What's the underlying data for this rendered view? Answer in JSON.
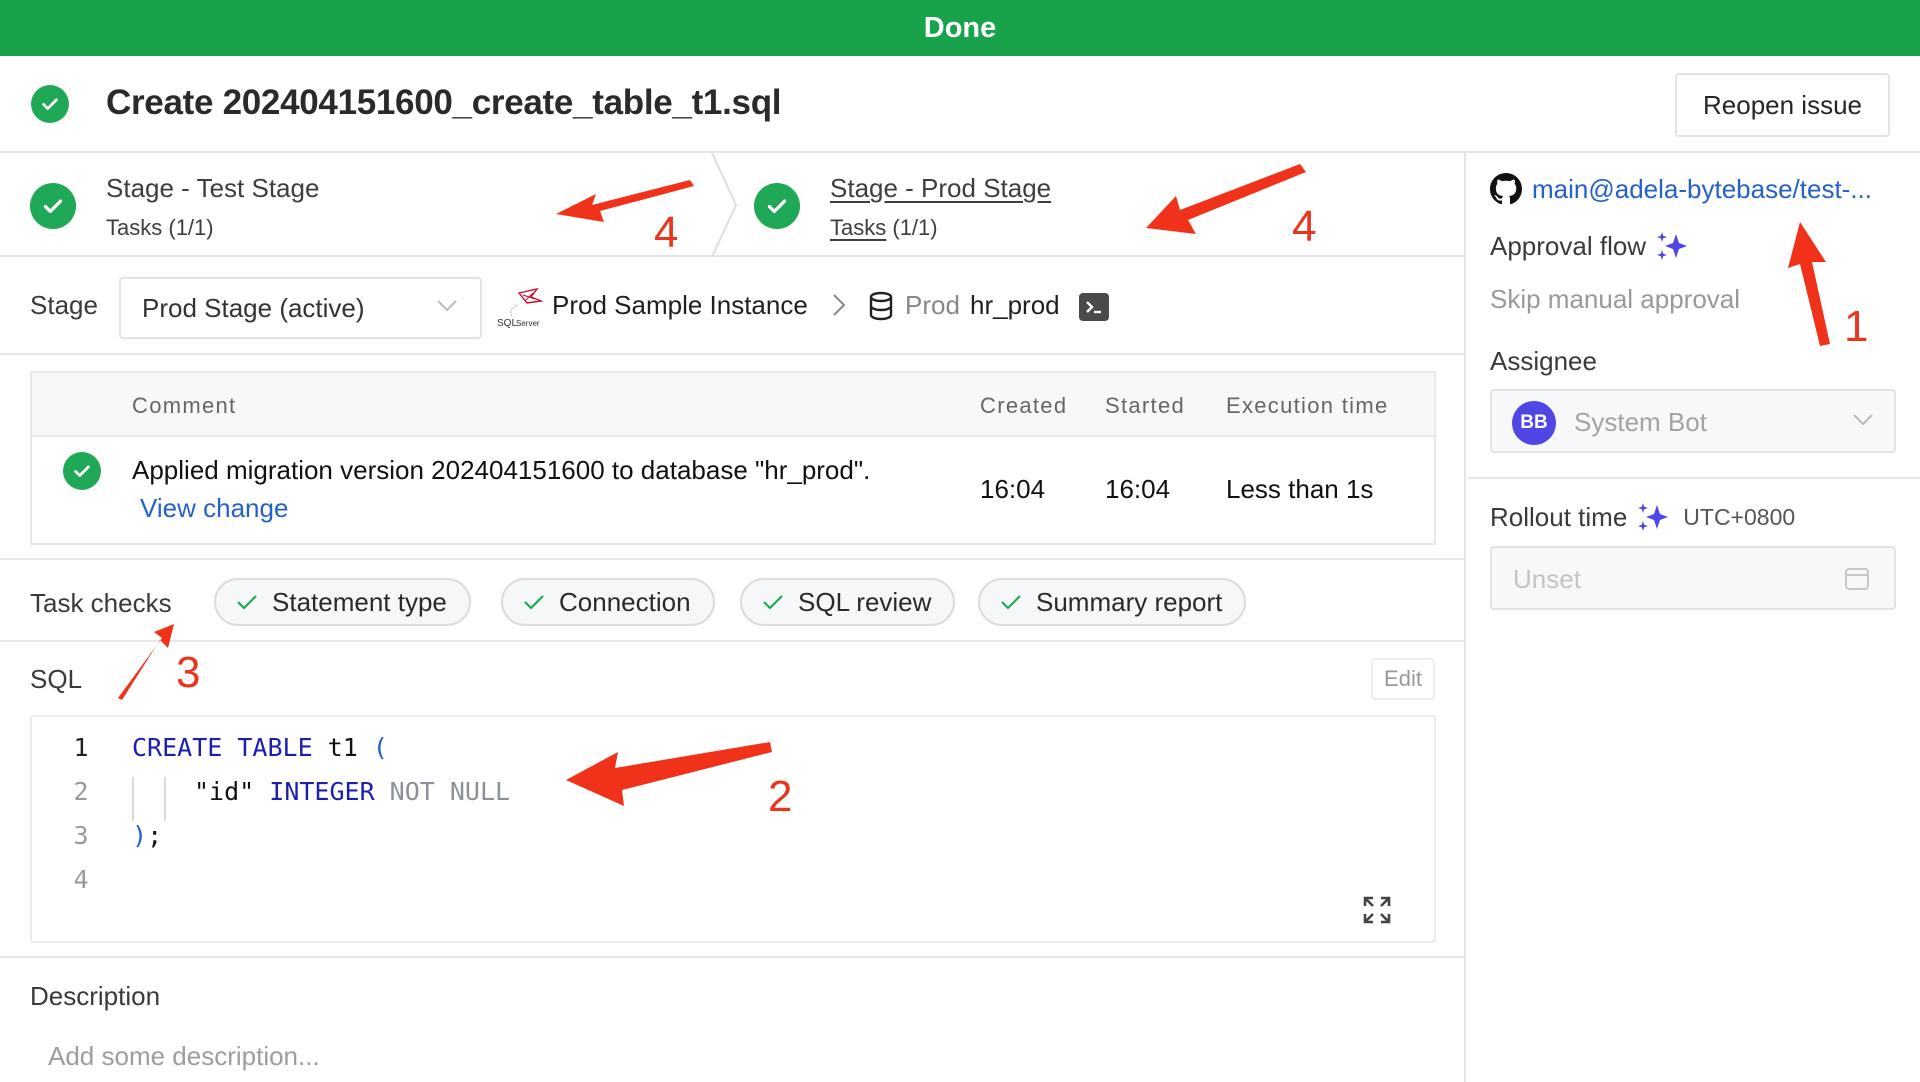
{
  "status_bar": {
    "label": "Done",
    "color": "#18a24a"
  },
  "header": {
    "title": "Create 202404151600_create_table_t1.sql",
    "reopen_button": "Reopen issue"
  },
  "stages": [
    {
      "title": "Stage - Test Stage",
      "tasks_label": "Tasks",
      "tasks_count": "(1/1)",
      "status": "done",
      "active": false
    },
    {
      "title": "Stage - Prod Stage",
      "tasks_label": "Tasks",
      "tasks_count": "(1/1)",
      "status": "done",
      "active": true
    }
  ],
  "stage_selector": {
    "label": "Stage",
    "selected": "Prod Stage (active)",
    "instance_logo": "SQL Server",
    "instance": "Prod Sample Instance",
    "db_environment": "Prod",
    "database": "hr_prod"
  },
  "task_table": {
    "columns": [
      "Comment",
      "Created",
      "Started",
      "Execution time"
    ],
    "rows": [
      {
        "status": "done",
        "comment": "Applied migration version 202404151600 to database \"hr_prod\".",
        "link": "View change",
        "created": "16:04",
        "started": "16:04",
        "execution_time": "Less than 1s"
      }
    ]
  },
  "task_checks": {
    "label": "Task checks",
    "items": [
      "Statement type",
      "Connection",
      "SQL review",
      "Summary report"
    ]
  },
  "sql": {
    "label": "SQL",
    "edit_button": "Edit",
    "lines": [
      {
        "number": "1",
        "tokens": [
          {
            "t": "CREATE TABLE",
            "c": "kw"
          },
          {
            "t": " t1 ",
            "c": ""
          },
          {
            "t": "(",
            "c": "punc"
          }
        ]
      },
      {
        "number": "2",
        "tokens": [
          {
            "t": "\"id\" ",
            "c": ""
          },
          {
            "t": "INTEGER",
            "c": "kw"
          },
          {
            "t": " NOT NULL",
            "c": "kw2"
          }
        ]
      },
      {
        "number": "3",
        "tokens": [
          {
            "t": ")",
            "c": "punc"
          },
          {
            "t": ";",
            "c": ""
          }
        ]
      },
      {
        "number": "4",
        "tokens": []
      }
    ]
  },
  "description": {
    "label": "Description",
    "placeholder": "Add some description..."
  },
  "sidebar": {
    "repo_link": "main@adela-bytebase/test-...",
    "approval_flow_label": "Approval flow",
    "approval_flow_value": "Skip manual approval",
    "assignee_label": "Assignee",
    "assignee_initials": "BB",
    "assignee_name": "System Bot",
    "rollout_time_label": "Rollout time",
    "timezone": "UTC+0800",
    "rollout_placeholder": "Unset"
  },
  "annotations": [
    "1",
    "2",
    "3",
    "4",
    "4"
  ],
  "colors": {
    "success": "#1fa855",
    "link": "#2462c9",
    "accent": "#4f46e5",
    "annotation": "#e8361e"
  }
}
